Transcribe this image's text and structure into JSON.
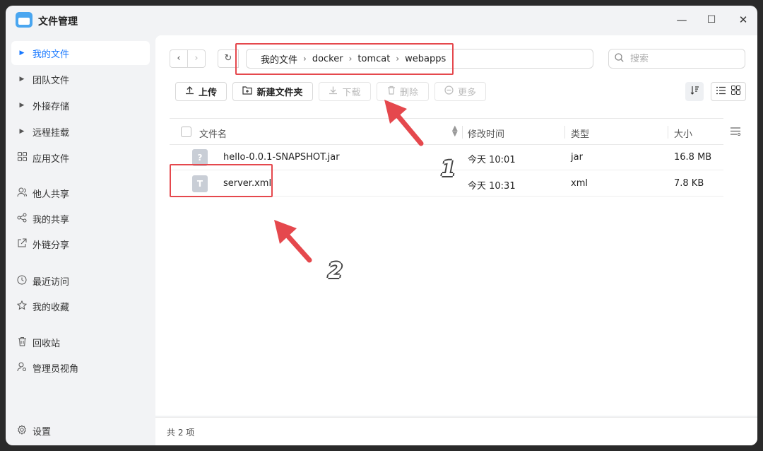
{
  "app": {
    "title": "文件管理",
    "icon": "folder-app-icon"
  },
  "window_controls": {
    "minimize": "—",
    "maximize": "☐",
    "close": "✕"
  },
  "sidebar": {
    "items": [
      {
        "label": "我的文件",
        "icon": "caret-right-icon",
        "active": true
      },
      {
        "label": "团队文件",
        "icon": "caret-right-icon"
      },
      {
        "label": "外接存储",
        "icon": "caret-right-icon"
      },
      {
        "label": "远程挂载",
        "icon": "caret-right-icon"
      },
      {
        "label": "应用文件",
        "icon": "apps-grid-icon"
      },
      {
        "label": "他人共享",
        "icon": "users-icon"
      },
      {
        "label": "我的共享",
        "icon": "share-icon"
      },
      {
        "label": "外链分享",
        "icon": "external-link-icon"
      },
      {
        "label": "最近访问",
        "icon": "clock-icon"
      },
      {
        "label": "我的收藏",
        "icon": "star-icon"
      },
      {
        "label": "回收站",
        "icon": "trash-icon"
      },
      {
        "label": "管理员视角",
        "icon": "admin-user-icon"
      }
    ],
    "settings_label": "设置"
  },
  "toolbar": {
    "back": "‹",
    "forward": "›",
    "refresh": "↻",
    "breadcrumb": [
      "我的文件",
      "docker",
      "tomcat",
      "webapps"
    ],
    "breadcrumb_sep": "›",
    "search_placeholder": "搜索",
    "upload_label": "上传",
    "new_folder_label": "新建文件夹",
    "download_label": "下载",
    "delete_label": "删除",
    "more_label": "更多"
  },
  "table": {
    "headers": {
      "name": "文件名",
      "modified": "修改时间",
      "type": "类型",
      "size": "大小"
    },
    "rows": [
      {
        "icon_glyph": "?",
        "name": "hello-0.0.1-SNAPSHOT.jar",
        "modified": "今天 10:01",
        "type": "jar",
        "size": "16.8 MB"
      },
      {
        "icon_glyph": "T",
        "name": "server.xml",
        "modified": "今天 10:31",
        "type": "xml",
        "size": "7.8 KB"
      }
    ]
  },
  "footer": {
    "count_label": "共 2 项"
  },
  "annotations": {
    "label_1": "1",
    "label_2": "2",
    "color": "#e5484d"
  }
}
